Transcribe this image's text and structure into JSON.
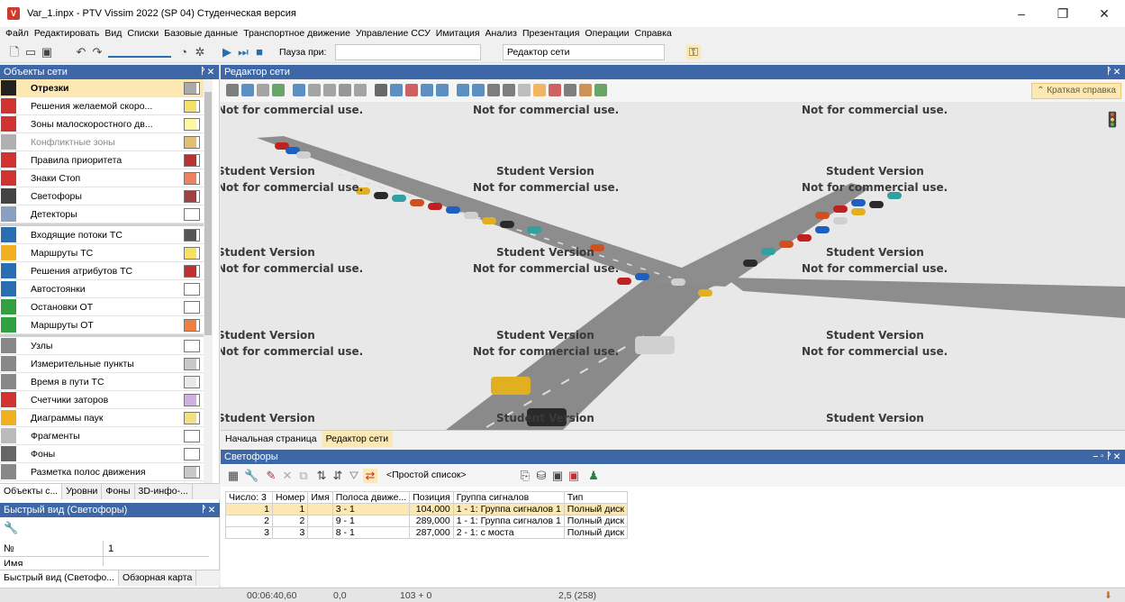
{
  "window": {
    "title": "Var_1.inpx - PTV Vissim 2022 (SP 04) Студенческая версия",
    "min": "–",
    "max": "❐",
    "close": "✕"
  },
  "menu": [
    "Файл",
    "Редактировать",
    "Вид",
    "Списки",
    "Базовые данные",
    "Транспортное движение",
    "Управление ССУ",
    "Имитация",
    "Анализ",
    "Презентация",
    "Операции",
    "Справка"
  ],
  "toolbar": {
    "pause_label": "Пауза при:",
    "pause_value": "",
    "view_value": "Редактор сети"
  },
  "network_objects": {
    "title": "Объекты сети",
    "pin": "ᚹ ✕",
    "items": [
      {
        "label": "Отрезки",
        "icon_color": "#222",
        "swatch": "#aaaaaa"
      },
      {
        "label": "Решения желаемой скоро...",
        "icon_color": "#d23232",
        "swatch": "#f5e06a"
      },
      {
        "label": "Зоны малоскоростного дв...",
        "icon_color": "#d23232",
        "swatch": "#fff7a0"
      },
      {
        "label": "Конфликтные зоны",
        "icon_color": "#b0b0b0",
        "swatch": "#e0c070"
      },
      {
        "label": "Правила приоритета",
        "icon_color": "#d23232",
        "swatch": "#b83232"
      },
      {
        "label": "Знаки Стоп",
        "icon_color": "#d23232",
        "swatch": "#f08060"
      },
      {
        "label": "Светофоры",
        "icon_color": "#444",
        "swatch": "#a04040"
      },
      {
        "label": "Детекторы",
        "icon_color": "#8aa0c0",
        "swatch": "#ffffff"
      },
      {
        "label": "Входящие потоки ТС",
        "icon_color": "#2a6db0",
        "swatch": "#555555"
      },
      {
        "label": "Маршруты ТС",
        "icon_color": "#f0b020",
        "swatch": "#f5e060"
      },
      {
        "label": "Решения атрибутов ТС",
        "icon_color": "#2a6db0",
        "swatch": "#c03030"
      },
      {
        "label": "Автостоянки",
        "icon_color": "#2a6db0",
        "swatch": "#ffffff"
      },
      {
        "label": "Остановки ОТ",
        "icon_color": "#30a040",
        "swatch": "#ffffff"
      },
      {
        "label": "Маршруты ОТ",
        "icon_color": "#30a040",
        "swatch": "#f08040"
      },
      {
        "label": "Узлы",
        "icon_color": "#888",
        "swatch": "#ffffff"
      },
      {
        "label": "Измерительные пункты",
        "icon_color": "#888",
        "swatch": "#c8c8c8"
      },
      {
        "label": "Время в пути ТС",
        "icon_color": "#888",
        "swatch": "#e8e8e8"
      },
      {
        "label": "Счетчики заторов",
        "icon_color": "#d23232",
        "swatch": "#d0b0e0"
      },
      {
        "label": "Диаграммы паук",
        "icon_color": "#f0b020",
        "swatch": "#f0e080"
      },
      {
        "label": "Фрагменты",
        "icon_color": "#bbb",
        "swatch": "#ffffff"
      },
      {
        "label": "Фоны",
        "icon_color": "#666",
        "swatch": "#ffffff"
      },
      {
        "label": "Разметка полос движения",
        "icon_color": "#888",
        "swatch": "#c8c8c8"
      }
    ],
    "tabs": [
      "Объекты с...",
      "Уровни",
      "Фоны",
      "3D-инфо-..."
    ]
  },
  "quick_view": {
    "title": "Быстрый вид (Светофоры)",
    "rows": [
      {
        "k": "№",
        "v": "1"
      },
      {
        "k": "Имя",
        "v": ""
      }
    ],
    "tabs": [
      "Быстрый вид (Светофо...",
      "Обзорная карта"
    ]
  },
  "editor": {
    "title": "Редактор сети",
    "help": "⌃ Краткая справка",
    "watermark1": "Student Version",
    "watermark2": "Not for commercial use.",
    "tabs": [
      "Начальная страница",
      "Редактор сети"
    ]
  },
  "signals": {
    "title": "Светофоры",
    "list_mode": "<Простой список>",
    "count_label": "Число: 3",
    "columns": [
      "Номер",
      "Имя",
      "Полоса движе...",
      "Позиция",
      "Группа сигналов",
      "Тип"
    ],
    "rows": [
      {
        "n": "1",
        "no": "1",
        "name": "",
        "lane": "3 - 1",
        "pos": "104,000",
        "grp": "1 - 1: Группа сигналов 1",
        "type": "Полный диск"
      },
      {
        "n": "2",
        "no": "2",
        "name": "",
        "lane": "9 - 1",
        "pos": "289,000",
        "grp": "1 - 1: Группа сигналов 1",
        "type": "Полный диск"
      },
      {
        "n": "3",
        "no": "3",
        "name": "",
        "lane": "8 - 1",
        "pos": "287,000",
        "grp": "2 - 1: с моста",
        "type": "Полный диск"
      }
    ]
  },
  "status": {
    "time": "00:06:40,60",
    "speed": "0,0",
    "vehicles": "103 + 0",
    "ratio": "2,5 (258)"
  },
  "colors": {
    "accent": "#3e67a8",
    "highlight": "#fce8b2",
    "road": "#8c8c8c"
  }
}
